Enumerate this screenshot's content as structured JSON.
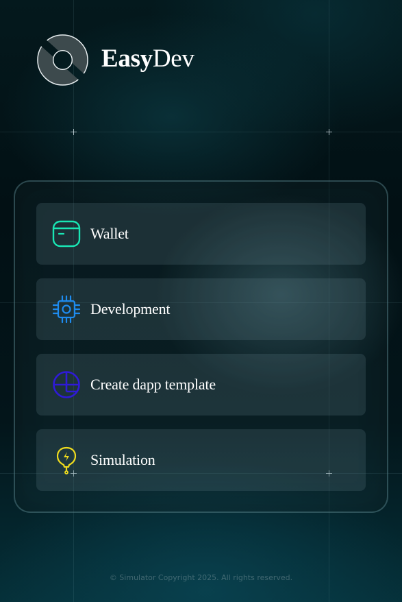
{
  "brand": {
    "name_bold": "Easy",
    "name_light": "Dev",
    "logo_icon": "ring-logo-icon"
  },
  "menu": {
    "items": [
      {
        "label": "Wallet",
        "icon": "wallet-icon",
        "color": "#19e6b4"
      },
      {
        "label": "Development",
        "icon": "chip-icon",
        "color": "#1e8cf0"
      },
      {
        "label": "Create dapp template",
        "icon": "template-grid-icon",
        "color": "#2f1ad8"
      },
      {
        "label": "Simulation",
        "icon": "lightning-bulb-icon",
        "color": "#f0dc1e"
      }
    ]
  },
  "footer": {
    "copyright": "© Simulator Copyright 2025. All rights reserved."
  },
  "colors": {
    "background": "#021014",
    "panel_border": "#5a828c",
    "text": "#ffffff"
  }
}
